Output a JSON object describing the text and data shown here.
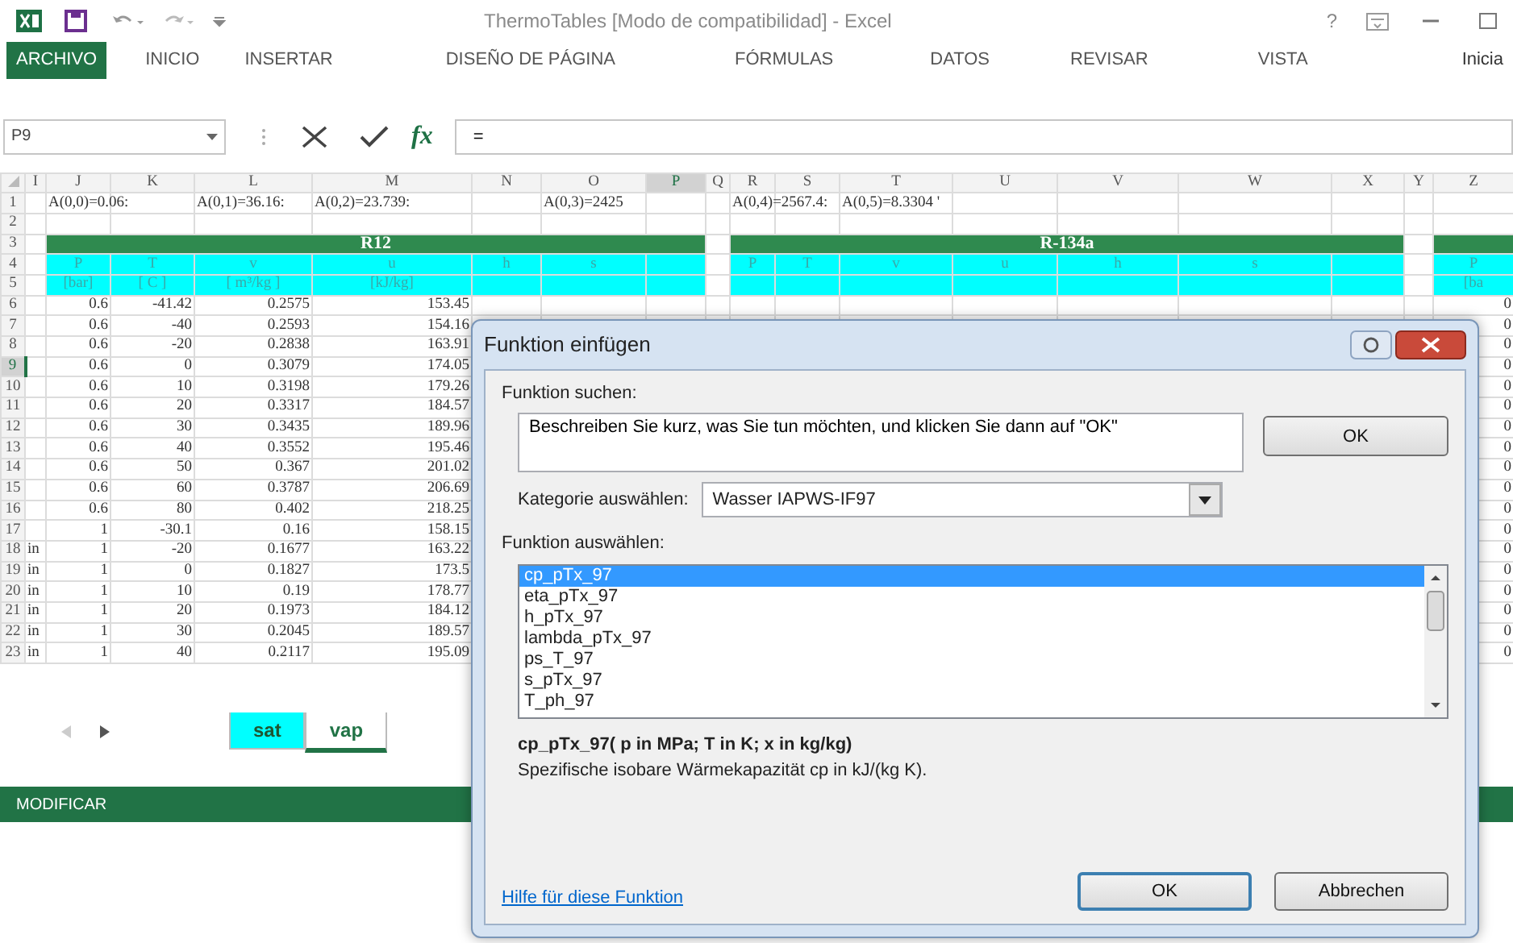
{
  "window": {
    "title": "ThermoTables  [Modo de compatibilidad] - Excel",
    "help": "?"
  },
  "ribbon_tabs": [
    {
      "label": "ARCHIVO",
      "kind": "file"
    },
    {
      "label": "INICIO",
      "kind": "tab"
    },
    {
      "label": "INSERTAR",
      "kind": "tab"
    },
    {
      "label": "DISEÑO DE PÁGINA",
      "kind": "tab"
    },
    {
      "label": "FÓRMULAS",
      "kind": "tab"
    },
    {
      "label": "DATOS",
      "kind": "tab"
    },
    {
      "label": "REVISAR",
      "kind": "tab"
    },
    {
      "label": "VISTA",
      "kind": "tab"
    },
    {
      "label": "Inicia",
      "kind": "account"
    }
  ],
  "formula_bar": {
    "name_box": "P9",
    "function_button": "fx",
    "formula": "="
  },
  "sheet": {
    "columns": [
      {
        "letter": "I",
        "kind": "spacer",
        "selected": false
      },
      {
        "letter": "J",
        "kind": "data",
        "selected": false
      },
      {
        "letter": "K",
        "kind": "data",
        "selected": false
      },
      {
        "letter": "L",
        "kind": "data",
        "selected": false
      },
      {
        "letter": "M",
        "kind": "data",
        "selected": false
      },
      {
        "letter": "N",
        "kind": "data",
        "selected": false
      },
      {
        "letter": "O",
        "kind": "data",
        "selected": false
      },
      {
        "letter": "P",
        "kind": "data",
        "selected": true
      },
      {
        "letter": "Q",
        "kind": "spacer",
        "selected": false
      },
      {
        "letter": "R",
        "kind": "data",
        "selected": false
      },
      {
        "letter": "S",
        "kind": "data",
        "selected": false
      },
      {
        "letter": "T",
        "kind": "data",
        "selected": false
      },
      {
        "letter": "U",
        "kind": "data",
        "selected": false
      },
      {
        "letter": "V",
        "kind": "data",
        "selected": false
      },
      {
        "letter": "W",
        "kind": "data",
        "selected": false
      },
      {
        "letter": "X",
        "kind": "data",
        "selected": false
      },
      {
        "letter": "Y",
        "kind": "spacer",
        "selected": false
      },
      {
        "letter": "Z",
        "kind": "data",
        "selected": false
      }
    ],
    "rows": [
      {
        "number": "1",
        "kind": "text",
        "selected": false,
        "cells": [
          null,
          "A(0,0)=0.06:",
          null,
          "A(0,1)=36.16:",
          "A(0,2)=23.739:",
          null,
          "A(0,3)=2425",
          null,
          null,
          "A(0,4)=2567.4:",
          null,
          "A(0,5)=8.3304 '",
          null,
          null,
          null,
          null,
          null,
          null
        ]
      },
      {
        "number": "2",
        "kind": "text",
        "selected": false,
        "cells": [
          null,
          null,
          null,
          null,
          null,
          null,
          null,
          null,
          null,
          null,
          null,
          null,
          null,
          null,
          null,
          null,
          null,
          null
        ]
      },
      {
        "number": "3",
        "kind": "title",
        "selected": false,
        "titles": [
          "R12",
          "R-134a"
        ]
      },
      {
        "number": "4",
        "kind": "fields",
        "selected": false,
        "cells": [
          null,
          "P",
          "T",
          "v",
          "u",
          "h",
          "s",
          null,
          null,
          "P",
          "T",
          "v",
          "u",
          "h",
          "s",
          null,
          null,
          "P"
        ]
      },
      {
        "number": "5",
        "kind": "fields",
        "selected": false,
        "cells": [
          null,
          "[bar]",
          "[ C ]",
          "[ m³/kg ]",
          "[kJ/kg]",
          null,
          null,
          null,
          null,
          null,
          null,
          null,
          null,
          null,
          null,
          null,
          null,
          "[ba"
        ]
      },
      {
        "number": "6",
        "kind": "data",
        "selected": false,
        "cells": [
          null,
          "0.6",
          "-41.42",
          "0.2575",
          "153.45",
          null,
          null,
          null,
          null,
          null,
          null,
          null,
          null,
          null,
          null,
          null,
          null,
          "0"
        ]
      },
      {
        "number": "7",
        "kind": "data",
        "selected": false,
        "cells": [
          null,
          "0.6",
          "-40",
          "0.2593",
          "154.16",
          null,
          null,
          null,
          null,
          null,
          null,
          null,
          null,
          null,
          null,
          null,
          null,
          "0"
        ]
      },
      {
        "number": "8",
        "kind": "data",
        "selected": false,
        "cells": [
          null,
          "0.6",
          "-20",
          "0.2838",
          "163.91",
          null,
          null,
          null,
          null,
          null,
          null,
          null,
          null,
          null,
          null,
          null,
          null,
          "0"
        ]
      },
      {
        "number": "9",
        "kind": "data",
        "selected": true,
        "cells": [
          null,
          "0.6",
          "0",
          "0.3079",
          "174.05",
          null,
          null,
          null,
          null,
          null,
          null,
          null,
          null,
          null,
          null,
          null,
          null,
          "0"
        ]
      },
      {
        "number": "10",
        "kind": "data",
        "selected": false,
        "cells": [
          null,
          "0.6",
          "10",
          "0.3198",
          "179.26",
          null,
          null,
          null,
          null,
          null,
          null,
          null,
          null,
          null,
          null,
          null,
          null,
          "0"
        ]
      },
      {
        "number": "11",
        "kind": "data",
        "selected": false,
        "cells": [
          null,
          "0.6",
          "20",
          "0.3317",
          "184.57",
          null,
          null,
          null,
          null,
          null,
          null,
          null,
          null,
          null,
          null,
          null,
          null,
          "0"
        ]
      },
      {
        "number": "12",
        "kind": "data",
        "selected": false,
        "cells": [
          null,
          "0.6",
          "30",
          "0.3435",
          "189.96",
          null,
          null,
          null,
          null,
          null,
          null,
          null,
          null,
          null,
          null,
          null,
          null,
          "0"
        ]
      },
      {
        "number": "13",
        "kind": "data",
        "selected": false,
        "cells": [
          null,
          "0.6",
          "40",
          "0.3552",
          "195.46",
          null,
          null,
          null,
          null,
          null,
          null,
          null,
          null,
          null,
          null,
          null,
          null,
          "0"
        ]
      },
      {
        "number": "14",
        "kind": "data",
        "selected": false,
        "cells": [
          null,
          "0.6",
          "50",
          "0.367",
          "201.02",
          null,
          null,
          null,
          null,
          null,
          null,
          null,
          null,
          null,
          null,
          null,
          null,
          "0"
        ]
      },
      {
        "number": "15",
        "kind": "data",
        "selected": false,
        "cells": [
          null,
          "0.6",
          "60",
          "0.3787",
          "206.69",
          null,
          null,
          null,
          null,
          null,
          null,
          null,
          null,
          null,
          null,
          null,
          null,
          "0"
        ]
      },
      {
        "number": "16",
        "kind": "data",
        "selected": false,
        "cells": [
          null,
          "0.6",
          "80",
          "0.402",
          "218.25",
          null,
          null,
          null,
          null,
          null,
          null,
          null,
          null,
          null,
          null,
          null,
          null,
          "0"
        ]
      },
      {
        "number": "17",
        "kind": "data",
        "selected": false,
        "cells": [
          null,
          "1",
          "-30.1",
          "0.16",
          "158.15",
          null,
          null,
          null,
          null,
          null,
          null,
          null,
          null,
          null,
          null,
          null,
          null,
          "0"
        ]
      },
      {
        "number": "18",
        "kind": "data",
        "selected": false,
        "cells": [
          "in",
          "1",
          "-20",
          "0.1677",
          "163.22",
          null,
          null,
          null,
          null,
          null,
          null,
          null,
          null,
          null,
          null,
          null,
          null,
          "0"
        ]
      },
      {
        "number": "19",
        "kind": "data",
        "selected": false,
        "cells": [
          "in",
          "1",
          "0",
          "0.1827",
          "173.5",
          null,
          null,
          null,
          null,
          null,
          null,
          null,
          null,
          null,
          null,
          null,
          null,
          "0"
        ]
      },
      {
        "number": "20",
        "kind": "data",
        "selected": false,
        "cells": [
          "in",
          "1",
          "10",
          "0.19",
          "178.77",
          null,
          null,
          null,
          null,
          null,
          null,
          null,
          null,
          null,
          null,
          null,
          null,
          "0"
        ]
      },
      {
        "number": "21",
        "kind": "data",
        "selected": false,
        "cells": [
          "in",
          "1",
          "20",
          "0.1973",
          "184.12",
          null,
          null,
          null,
          null,
          null,
          null,
          null,
          null,
          null,
          null,
          null,
          null,
          "0"
        ]
      },
      {
        "number": "22",
        "kind": "data",
        "selected": false,
        "cells": [
          "in",
          "1",
          "30",
          "0.2045",
          "189.57",
          null,
          null,
          null,
          null,
          null,
          null,
          null,
          null,
          null,
          null,
          null,
          null,
          "0"
        ]
      },
      {
        "number": "23",
        "kind": "data",
        "selected": false,
        "cells": [
          "in",
          "1",
          "40",
          "0.2117",
          "195.09",
          null,
          null,
          null,
          null,
          null,
          null,
          null,
          null,
          null,
          null,
          null,
          null,
          "0"
        ]
      }
    ]
  },
  "sheet_tabs": [
    {
      "label": "sat",
      "selected": false,
      "color": "#00ffff"
    },
    {
      "label": "vap",
      "selected": true
    }
  ],
  "status_bar": {
    "mode": "MODIFICAR"
  },
  "dialog": {
    "title": "Funktion einfügen",
    "search_label": "Funktion suchen:",
    "search_value": "Beschreiben Sie kurz, was Sie tun möchten, und klicken Sie dann auf \"OK\"",
    "go_button": "OK",
    "category_label": "Kategorie auswählen:",
    "category": "Wasser IAPWS-IF97",
    "function_label": "Funktion auswählen:",
    "functions": [
      {
        "name": "cp_pTx_97",
        "selected": true
      },
      {
        "name": "eta_pTx_97",
        "selected": false
      },
      {
        "name": "h_pTx_97",
        "selected": false
      },
      {
        "name": "lambda_pTx_97",
        "selected": false
      },
      {
        "name": "ps_T_97",
        "selected": false
      },
      {
        "name": "s_pTx_97",
        "selected": false
      },
      {
        "name": "T_ph_97",
        "selected": false
      }
    ],
    "signature": "cp_pTx_97( p in MPa; T in K; x in kg/kg)",
    "description": "Spezifische isobare Wärmekapazität cp in kJ/(kg K).",
    "help_link": "Hilfe für diese Funktion",
    "buttons": [
      {
        "label": "OK",
        "kind": "default"
      },
      {
        "label": "Abbrechen",
        "kind": "normal"
      }
    ]
  }
}
